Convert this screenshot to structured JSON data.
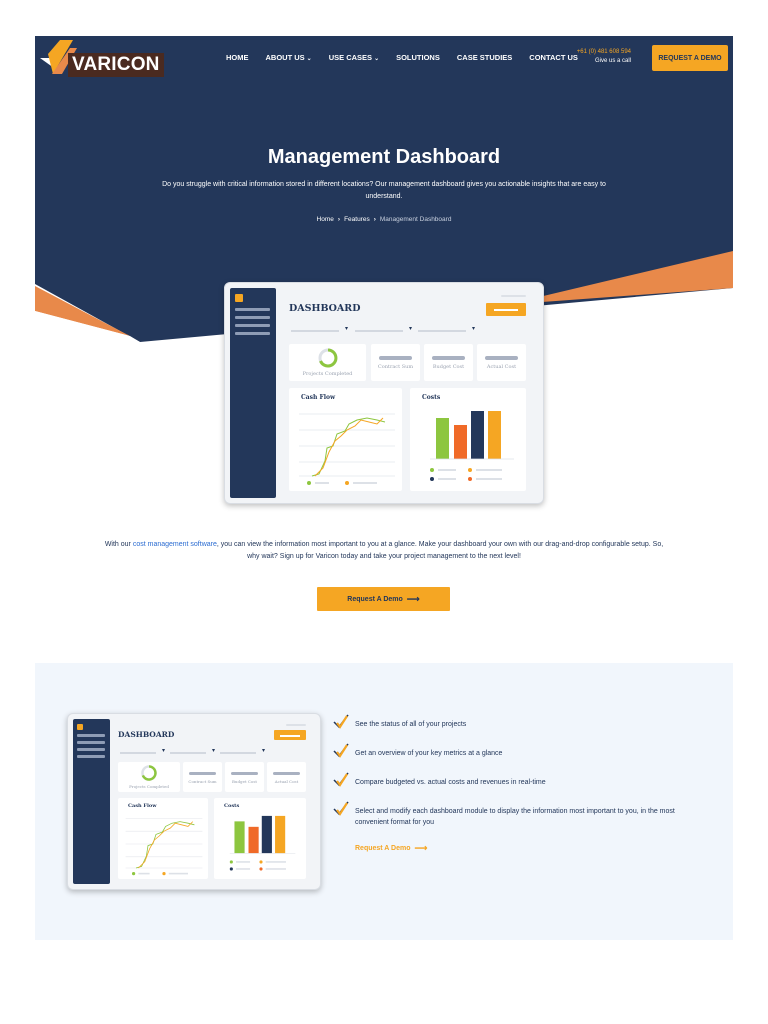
{
  "brand": {
    "name": "VARICON"
  },
  "nav": {
    "items": [
      {
        "label": "HOME",
        "has_dropdown": false
      },
      {
        "label": "ABOUT US",
        "has_dropdown": true
      },
      {
        "label": "USE CASES",
        "has_dropdown": true
      },
      {
        "label": "SOLUTIONS",
        "has_dropdown": false
      },
      {
        "label": "CASE STUDIES",
        "has_dropdown": false
      },
      {
        "label": "CONTACT US",
        "has_dropdown": false
      }
    ],
    "phone": "+61 (0) 481 608 594",
    "phone_sub": "Give us a call",
    "cta": "REQUEST A DEMO"
  },
  "hero": {
    "title": "Management Dashboard",
    "description": "Do you struggle with critical information stored in different locations? Our management dashboard gives you actionable insights that are easy to understand.",
    "breadcrumb": [
      "Home",
      "Features",
      "Management Dashboard"
    ]
  },
  "mockup": {
    "title": "DASHBOARD",
    "stats": [
      "Projects Completed",
      "Contract Sum",
      "Budget Cost",
      "Actual Cost"
    ],
    "cashflow_title": "Cash Flow",
    "costs_title": "Costs",
    "costs_title_small": "Costs"
  },
  "intro": {
    "prefix": "With our ",
    "link": "cost management software",
    "suffix": ", you can view the information most important to you at a glance. Make your dashboard your own with our drag-and-drop configurable setup. So, why wait? Sign up for Varicon today and take your project management to the next level!",
    "cta": "Request A Demo",
    "cta_arrow": "⟶"
  },
  "features": {
    "items": [
      "See the status of all of your projects",
      "Get an overview of your key metrics at a glance",
      "Compare budgeted vs. actual costs and revenues in real-time",
      "Select and modify each dashboard module to display the information most important to you, in the most convenient format for you"
    ],
    "cta": "Request A Demo",
    "cta_arrow": "⟶"
  },
  "colors": {
    "navy": "#23375a",
    "orange": "#f5a623",
    "orange_dark": "#e8894a",
    "green": "#8dc63f",
    "bar_orange": "#f06a28",
    "light_bg": "#f1f6fc"
  }
}
